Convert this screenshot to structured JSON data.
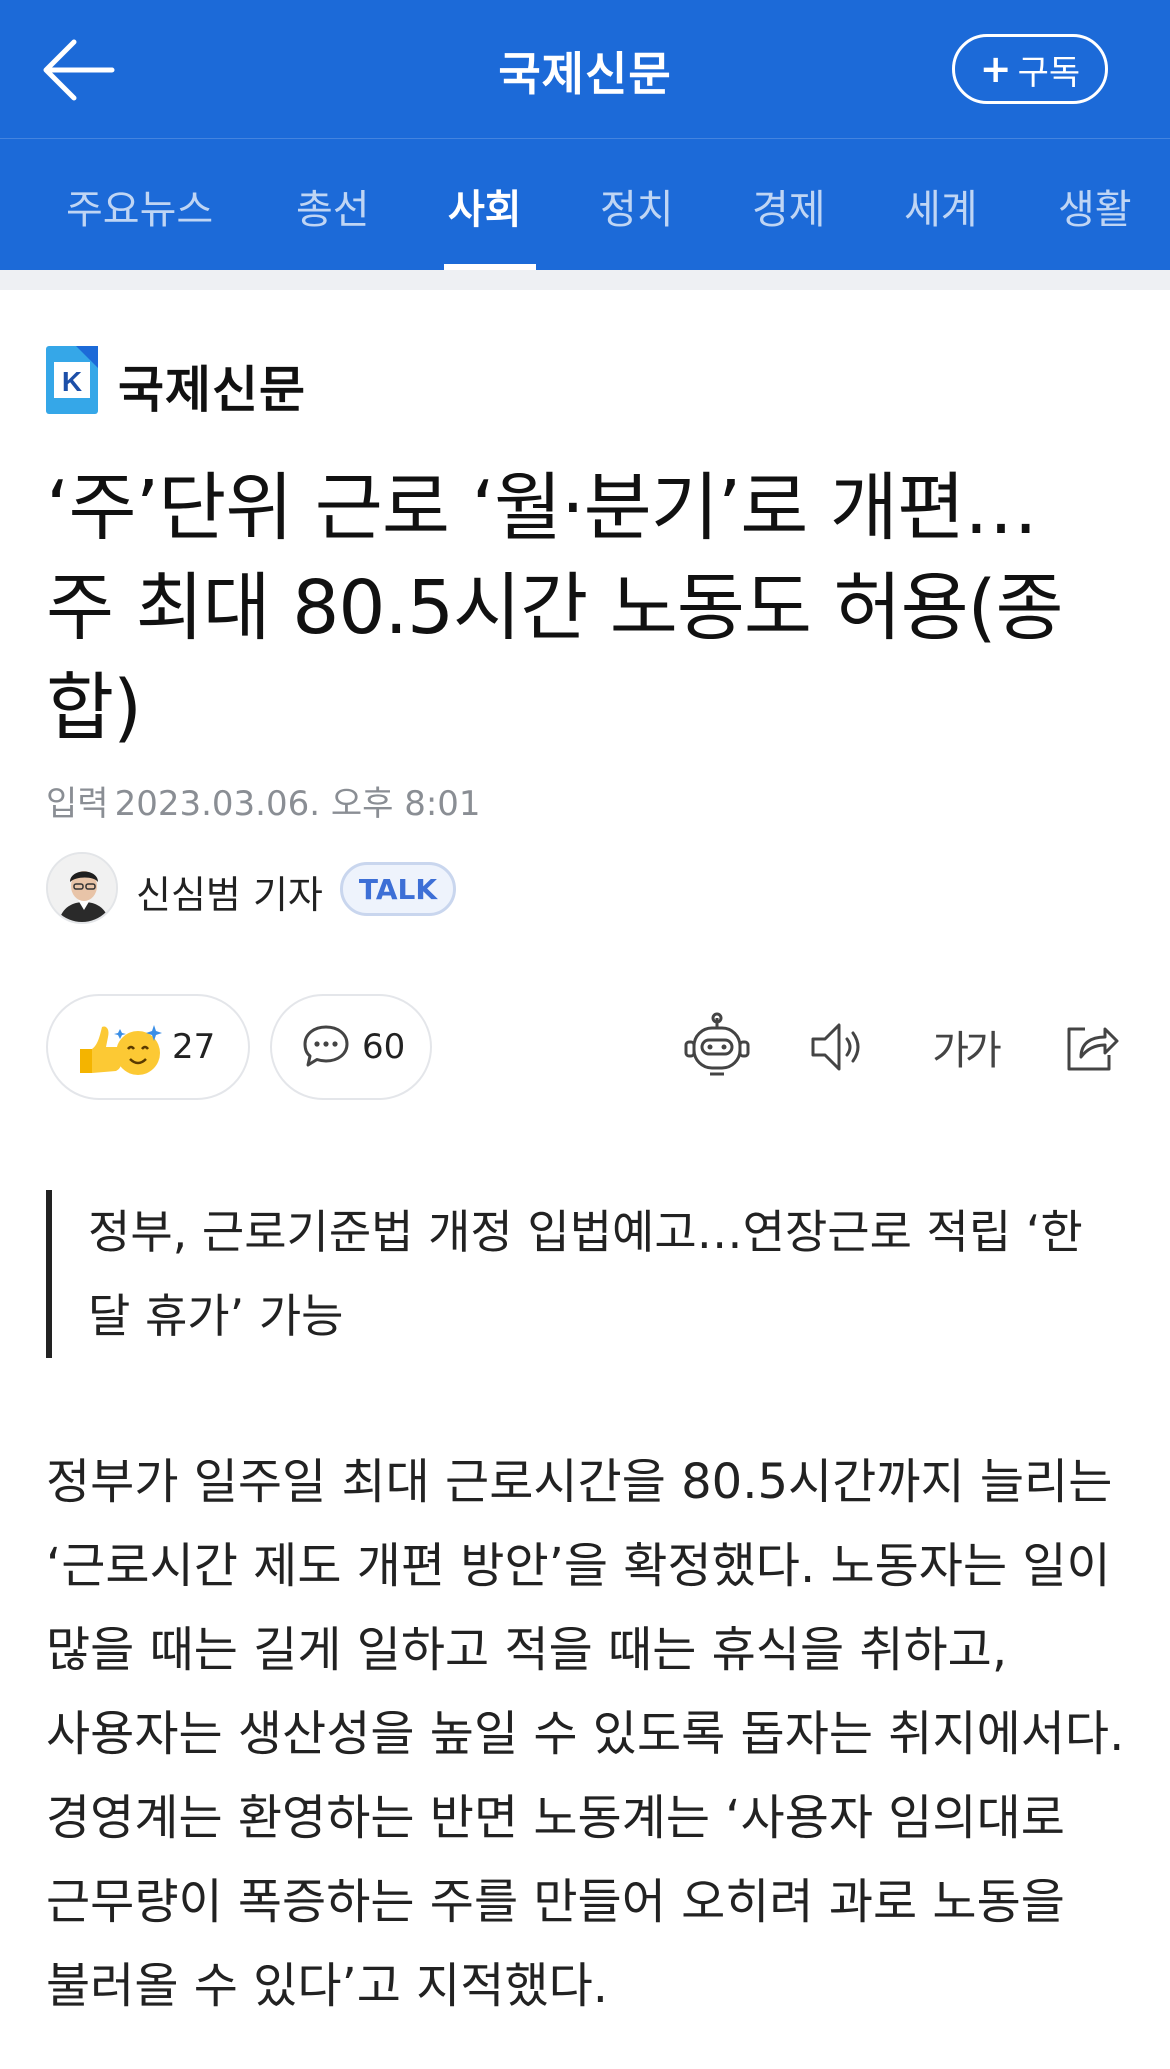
{
  "header": {
    "title": "국제신문",
    "subscribe_label": "구독",
    "back_icon": "arrow-left-icon",
    "background_color": "#1c6ad8"
  },
  "nav": {
    "tabs": [
      {
        "label": "주요뉴스",
        "active": false
      },
      {
        "label": "총선",
        "active": false
      },
      {
        "label": "사회",
        "active": true
      },
      {
        "label": "정치",
        "active": false
      },
      {
        "label": "경제",
        "active": false
      },
      {
        "label": "세계",
        "active": false
      },
      {
        "label": "생활",
        "active": false
      }
    ]
  },
  "article": {
    "publisher_name": "국제신문",
    "publisher_logo_letter": "K",
    "headline": "‘주’단위 근로 ‘월·분기’로 개편… 주 최대 80.5시간 노동도 허용(종합)",
    "date_label": "입력",
    "date_value": "2023.03.06. 오후 8:01",
    "author": "신심범 기자",
    "talk_label": "TALK",
    "summary": "정부, 근로기준법 개정 입법예고…연장근로 적립 ‘한 달 휴가’ 가능",
    "body": "정부가 일주일 최대 근로시간을 80.5시간까지 늘리는 ‘근로시간 제도 개편 방안’을 확정했다. 노동자는 일이 많을 때는 길게 일하고 적을 때는 휴식을 취하고, 사용자는 생산성을 높일 수 있도록 돕자는 취지에서다. 경영계는 환영하는 반면 노동계는 ‘사용자 임의대로 근무량이 폭증하는 주를 만들어 오히려 과로 노동을 불러올 수 있다’고 지적했다."
  },
  "actions": {
    "reactions_count": "27",
    "comments_count": "60",
    "font_size_label": "가가",
    "icons": [
      "reaction-emoji-icon",
      "comment-icon",
      "ai-robot-icon",
      "speaker-icon",
      "font-size-icon",
      "share-icon"
    ]
  }
}
